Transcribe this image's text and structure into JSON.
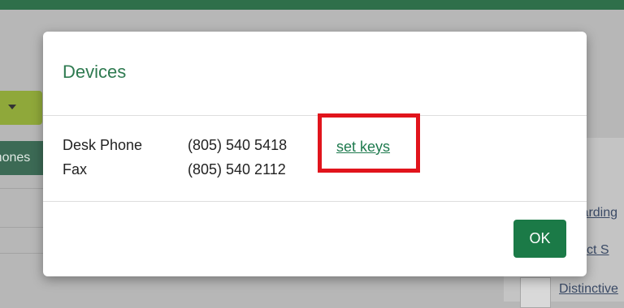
{
  "background": {
    "tab_label": "Phones",
    "panel_links": [
      "Forwarding",
      "Select S",
      "Distinctive"
    ]
  },
  "dialog": {
    "title": "Devices",
    "devices": [
      {
        "name": "Desk Phone",
        "number": "(805) 540 5418"
      },
      {
        "name": "Fax",
        "number": "(805) 540 2112"
      }
    ],
    "set_keys_label": "set keys",
    "ok_label": "OK"
  },
  "colors": {
    "accent_green": "#1b7a47",
    "title_green": "#2e7a50",
    "highlight_red": "#e1141c"
  }
}
